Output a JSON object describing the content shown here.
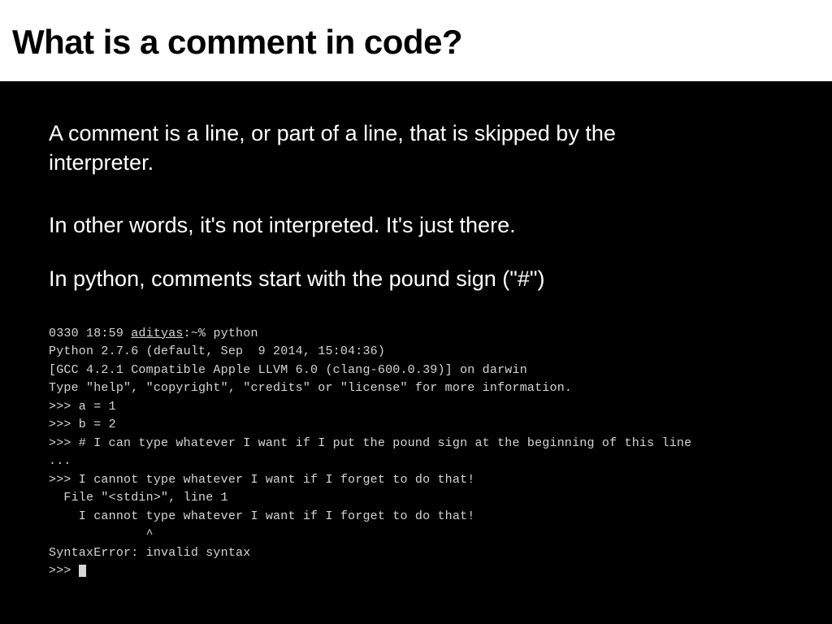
{
  "header": {
    "title": "What is a comment in code?"
  },
  "paragraphs": [
    "A comment is a line, or part of a line, that is skipped by the interpreter.",
    "In other words, it's not interpreted.  It's just there.",
    "In python, comments start with the pound sign (\"#\")"
  ],
  "terminal": {
    "prompt_time": "0330 18:59 ",
    "prompt_user": "adityas",
    "prompt_tail": ":~% python",
    "line2": "Python 2.7.6 (default, Sep  9 2014, 15:04:36)",
    "line3": "[GCC 4.2.1 Compatible Apple LLVM 6.0 (clang-600.0.39)] on darwin",
    "line4": "Type \"help\", \"copyright\", \"credits\" or \"license\" for more information.",
    "line5": ">>> a = 1",
    "line6": ">>> b = 2",
    "line7": ">>> # I can type whatever I want if I put the pound sign at the beginning of this line",
    "line8": "...",
    "line9": ">>> I cannot type whatever I want if I forget to do that!",
    "line10": "  File \"<stdin>\", line 1",
    "line11": "    I cannot type whatever I want if I forget to do that!",
    "line12": "             ^",
    "line13": "SyntaxError: invalid syntax",
    "line14": ">>> "
  }
}
